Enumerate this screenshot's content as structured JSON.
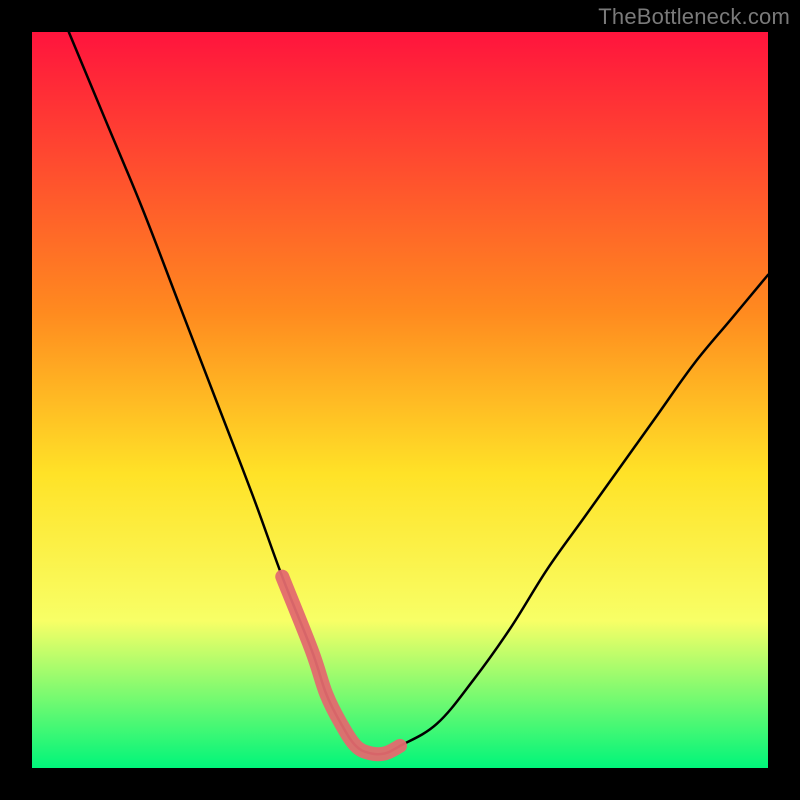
{
  "watermark": "TheBottleneck.com",
  "colors": {
    "bg": "#000000",
    "grad_top": "#ff143d",
    "grad_mid1": "#ff8a1f",
    "grad_mid2": "#ffe227",
    "grad_mid3": "#f8ff66",
    "grad_bottom": "#00f57a",
    "curve": "#000000",
    "highlight": "#e36a6f"
  },
  "chart_data": {
    "type": "line",
    "title": "",
    "xlabel": "",
    "ylabel": "",
    "xlim": [
      0,
      100
    ],
    "ylim": [
      0,
      100
    ],
    "series": [
      {
        "name": "bottleneck-curve",
        "x": [
          5,
          10,
          15,
          20,
          25,
          30,
          34,
          38,
          40,
          42,
          44,
          46,
          48,
          50,
          55,
          60,
          65,
          70,
          75,
          80,
          85,
          90,
          95,
          100
        ],
        "y": [
          100,
          88,
          76,
          63,
          50,
          37,
          26,
          16,
          10,
          6,
          3,
          2,
          2,
          3,
          6,
          12,
          19,
          27,
          34,
          41,
          48,
          55,
          61,
          67
        ]
      }
    ],
    "highlight_range_x": [
      34,
      50
    ],
    "notes": "V-shaped curve on a vertical red→green gradient. Minimum (≈2%) near x≈45. Highlighted pink segment spans x≈34–50 along the valley."
  }
}
